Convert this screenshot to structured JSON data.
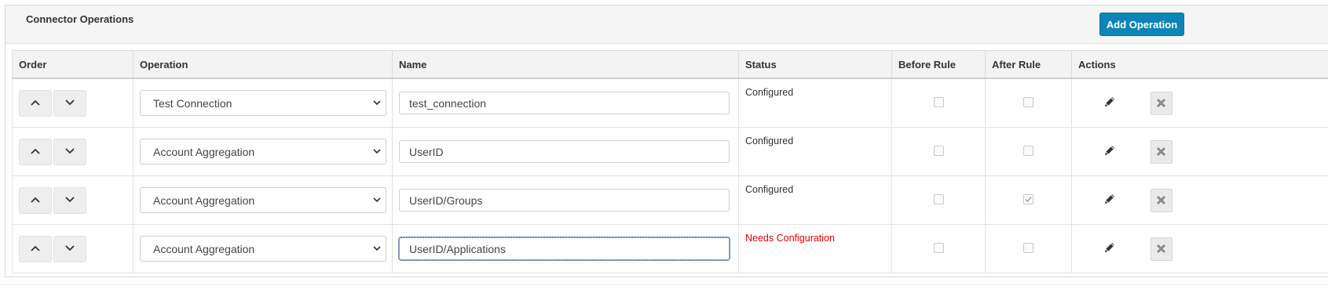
{
  "panel": {
    "title": "Connector Operations",
    "add_button_label": "Add Operation"
  },
  "table": {
    "columns": [
      "Order",
      "Operation",
      "Name",
      "Status",
      "Before Rule",
      "After Rule",
      "Actions"
    ],
    "rows": [
      {
        "operation": "Test Connection",
        "name": "test_connection",
        "status": "Configured",
        "before_rule": false,
        "after_rule": false
      },
      {
        "operation": "Account Aggregation",
        "name": "UserID",
        "status": "Configured",
        "before_rule": false,
        "after_rule": false
      },
      {
        "operation": "Account Aggregation",
        "name": "UserID/Groups",
        "status": "Configured",
        "before_rule": false,
        "after_rule": true
      },
      {
        "operation": "Account Aggregation",
        "name": "UserID/Applications",
        "status": "Needs Configuration",
        "before_rule": false,
        "after_rule": false
      }
    ]
  },
  "icons": {
    "move_up": "chevron-up-icon",
    "move_down": "chevron-down-icon",
    "edit": "pencil-icon",
    "delete": "close-x-icon",
    "select_dropdown": "chevron-down-icon"
  },
  "colors": {
    "accent_button": "#0f84b6",
    "warning_text": "#e00000"
  }
}
